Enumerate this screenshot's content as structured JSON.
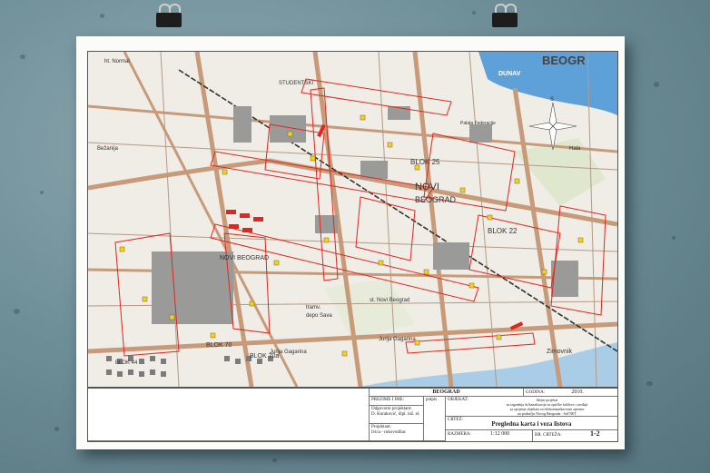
{
  "map": {
    "labels": {
      "novi_beograd_top": "NOVI",
      "novi_beograd_bottom": "BEOGRAD",
      "novi_beograd_west": "NOVI BEOGRAD",
      "blok_70": "BLOK 70",
      "blok_70a": "BLOK 70a",
      "blok_44": "BLOK 44",
      "blok_25": "BLOK 25",
      "blok_22": "BLOK 22",
      "jurija_gagarina_1": "Jurija Gagarina",
      "jurija_gagarina_2": "Jurija Gagarina",
      "zimovnik": "Zimovnik",
      "dunav": "DUNAV",
      "beograd_top": "BEOGR",
      "ht_normal": "ht. Normal",
      "tramvajsko_depo": "depo Sava",
      "tramvajsko": "tramv.",
      "stanica": "st. Novi Beograd",
      "bezanija": "Bežanija",
      "studentski": "STUDENTSKI",
      "hala": "Hala",
      "palata": "Palata Federacije"
    },
    "compass": {
      "north": "S"
    }
  },
  "title_block": {
    "city": "BEOGRAD",
    "godina_label": "GODINA:",
    "godina_value": "2010.",
    "objekat_label": "OBJEKAT:",
    "objekat_lines": [
      "Idejni projekat",
      "za izgradnju tk/kanalizacije za optičke kablove i uređaje",
      "za spojenje objekata za telekomunikacionu opremu",
      "na području Novog Beograda - SaTNET"
    ],
    "crtez_label": "CRTEŽ:",
    "crtez_value": "Pregledna karta i veza listova",
    "razmera_label": "RAZMERA:",
    "razmera_value": "1:12 000",
    "br_crteza_label": "BR. CRTEŽA:",
    "br_crteza_value": "1-2",
    "prezime_label": "PREZIME I IME:",
    "potpis_label": "potpis",
    "odg_projektant_label": "Odgovorni projektant:",
    "odg_projektant_value": "D. Kuraković, dipl. inž. el.",
    "projektant_label": "Projektant:",
    "projektant_value": "Ivica - rukovodilac"
  }
}
